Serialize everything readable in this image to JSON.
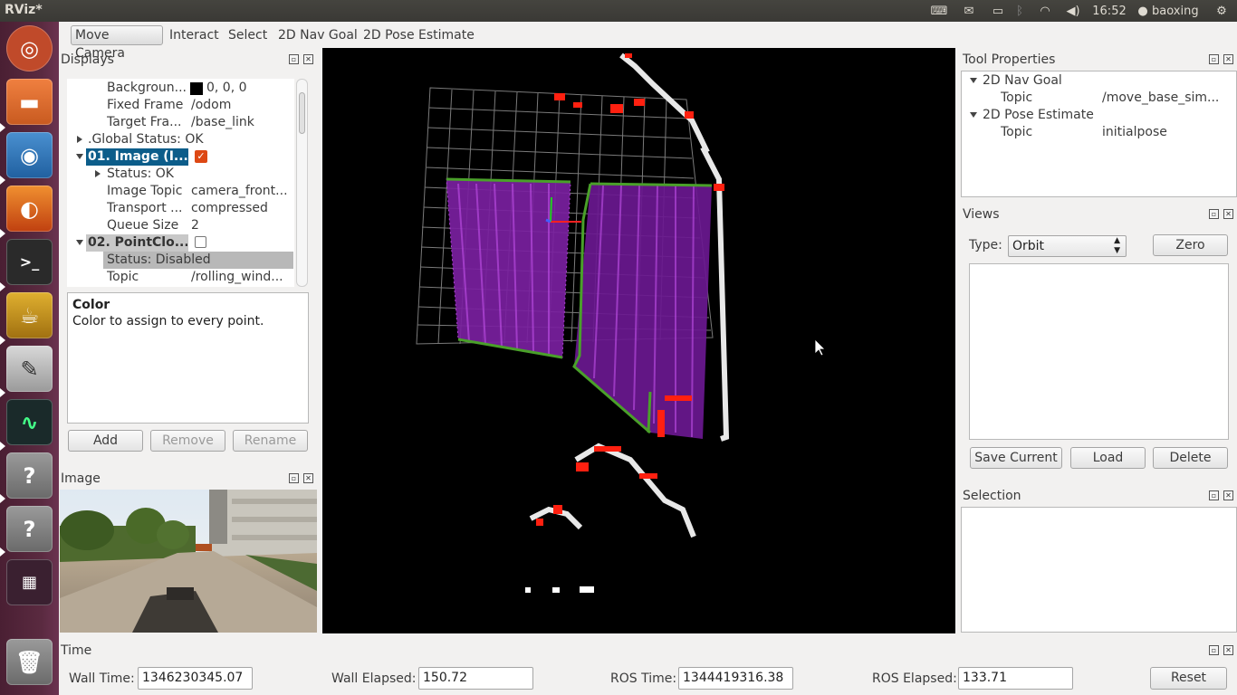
{
  "window": {
    "title": "RViz*"
  },
  "tray": {
    "clock": "16:52",
    "user": "baoxing"
  },
  "toolbar": {
    "tools": [
      "Move Camera",
      "Interact",
      "Select",
      "2D Nav Goal",
      "2D Pose Estimate"
    ],
    "active_tool": "Move Camera"
  },
  "displays": {
    "title": "Displays",
    "rows": [
      {
        "name": "Backgroun...",
        "value": "0, 0, 0"
      },
      {
        "name": "Fixed Frame",
        "value": "/odom"
      },
      {
        "name": "Target Fra...",
        "value": "/base_link"
      },
      {
        "name": ".Global Status: OK",
        "value": ""
      },
      {
        "name": "01. Image (I...",
        "value": ""
      },
      {
        "name": "Status: OK",
        "value": ""
      },
      {
        "name": "Image Topic",
        "value": "camera_front..."
      },
      {
        "name": "Transport ...",
        "value": "compressed"
      },
      {
        "name": "Queue Size",
        "value": "2"
      },
      {
        "name": "02. PointClo...",
        "value": ""
      },
      {
        "name": "Status: Disabled",
        "value": ""
      },
      {
        "name": "Topic",
        "value": "/rolling_wind..."
      }
    ],
    "description_title": "Color",
    "description_text": "Color to assign to every point.",
    "buttons": {
      "add": "Add",
      "remove": "Remove",
      "rename": "Rename"
    }
  },
  "image_panel": {
    "title": "Image"
  },
  "tool_properties": {
    "title": "Tool Properties",
    "rows": [
      {
        "name": "2D Nav Goal",
        "value": ""
      },
      {
        "name": "Topic",
        "value": "/move_base_sim..."
      },
      {
        "name": "2D Pose Estimate",
        "value": ""
      },
      {
        "name": "Topic",
        "value": "initialpose"
      }
    ]
  },
  "views": {
    "title": "Views",
    "type_label": "Type:",
    "type_value": "Orbit",
    "zero": "Zero",
    "save_current": "Save Current",
    "load": "Load",
    "delete": "Delete"
  },
  "selection": {
    "title": "Selection"
  },
  "time": {
    "title": "Time",
    "wall_time_label": "Wall Time:",
    "wall_time": "1346230345.07",
    "wall_elapsed_label": "Wall Elapsed:",
    "wall_elapsed": "150.72",
    "ros_time_label": "ROS Time:",
    "ros_time": "1344419316.38",
    "ros_elapsed_label": "ROS Elapsed:",
    "ros_elapsed": "133.71",
    "reset": "Reset"
  },
  "colors": {
    "accent": "#dd4814",
    "selected_row": "#0c5d8a",
    "point_cloud": "#a020c0",
    "ground_edge": "#4aa02a",
    "obstacle": "#ff2010"
  }
}
